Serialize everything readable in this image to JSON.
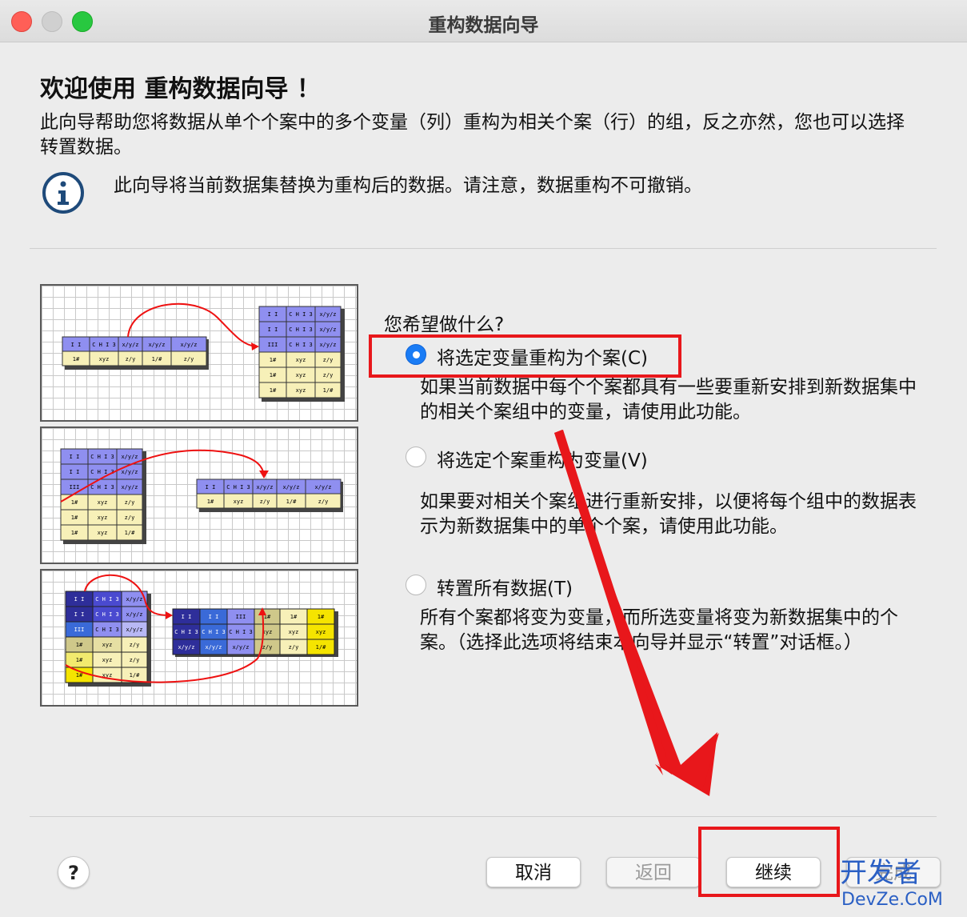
{
  "window": {
    "title": "重构数据向导"
  },
  "header": {
    "title": "欢迎使用 重构数据向导 ！",
    "intro": "此向导帮助您将数据从单个个案中的多个变量（列）重构为相关个案（行）的组，反之亦然，您也可以选择转置数据。",
    "notice": "此向导将当前数据集替换为重构后的数据。请注意，数据重构不可撤销。"
  },
  "options": {
    "question": "您希望做什么?",
    "items": [
      {
        "label": "将选定变量重构为个案(C)",
        "description": "如果当前数据中每个个案都具有一些要重新安排到新数据集中的相关个案组中的变量，请使用此功能。",
        "selected": true
      },
      {
        "label": "将选定个案重构为变量(V)",
        "description": "如果要对相关个案组进行重新安排，以便将每个组中的数据表示为新数据集中的单个个案，请使用此功能。",
        "selected": false
      },
      {
        "label": "转置所有数据(T)",
        "description": "所有个案都将变为变量，而所选变量将变为新数据集中的个案。（选择此选项将结束本向导并显示“转置”对话框。）",
        "selected": false
      }
    ]
  },
  "illustration": {
    "cells": {
      "id1": "I I",
      "id2": "II",
      "id3": "III",
      "ch": "C H I 3",
      "xy": "x/y/z",
      "r1": "1#",
      "r2": "xyz",
      "r3": "z/y",
      "r4": "1/#",
      "r5": "z/y"
    }
  },
  "footer": {
    "help": "?",
    "cancel": "取消",
    "back": "返回",
    "continue": "继续",
    "finish": "完成"
  },
  "watermark": {
    "line1": "开发者",
    "line2": "DevZe.CoM"
  },
  "colors": {
    "accent": "#1a7cf5",
    "annotation": "#e8171b"
  }
}
